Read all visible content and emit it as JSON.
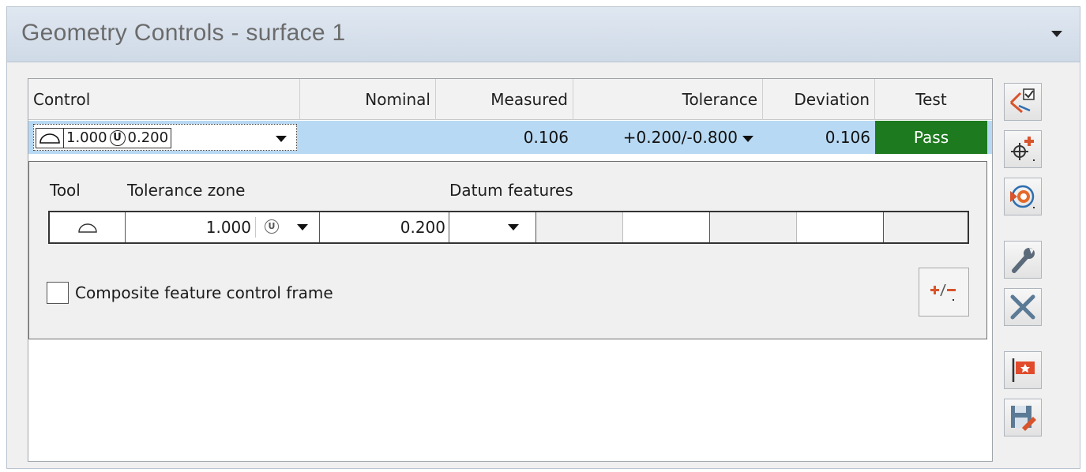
{
  "window": {
    "title": "Geometry Controls - surface 1"
  },
  "table": {
    "headers": {
      "control": "Control",
      "nominal": "Nominal",
      "measured": "Measured",
      "tolerance": "Tolerance",
      "deviation": "Deviation",
      "test": "Test"
    },
    "row": {
      "control_tolerance": "1.000",
      "control_modifier": "U",
      "control_value": "0.200",
      "nominal": "",
      "measured": "0.106",
      "tolerance": "+0.200/-0.800",
      "deviation": "0.106",
      "test": "Pass"
    }
  },
  "details": {
    "labels": {
      "tool": "Tool",
      "tolerance_zone": "Tolerance zone",
      "datum_features": "Datum features"
    },
    "tolerance_zone_value": "1.000",
    "tolerance_zone_modifier": "U",
    "second_value": "0.200",
    "composite_label": "Composite feature control frame",
    "composite_checked": false
  },
  "colors": {
    "pass": "#1e7a1e",
    "selected_row": "#b8d9f3"
  },
  "icons": {
    "tool_symbol": "profile-of-surface-icon",
    "sidebar": [
      "evaluate-checklist-icon",
      "add-point-icon",
      "rotate-target-icon",
      "wrench-icon",
      "delete-icon",
      "flag-icon",
      "save-edit-icon"
    ],
    "plus_minus": "plus-minus-icon"
  }
}
